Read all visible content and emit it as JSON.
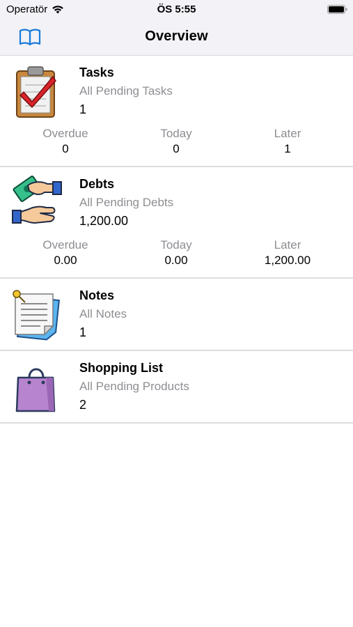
{
  "status_bar": {
    "carrier": "Operatör",
    "time": "ÖS 5:55"
  },
  "nav": {
    "title": "Overview",
    "left_icon": "book-icon"
  },
  "accent_color": "#1a7bd8",
  "sections": {
    "tasks": {
      "title": "Tasks",
      "subtitle": "All Pending Tasks",
      "count": "1",
      "stats": [
        {
          "label": "Overdue",
          "value": "0"
        },
        {
          "label": "Today",
          "value": "0"
        },
        {
          "label": "Later",
          "value": "1"
        }
      ]
    },
    "debts": {
      "title": "Debts",
      "subtitle": "All Pending Debts",
      "count": "1,200.00",
      "stats": [
        {
          "label": "Overdue",
          "value": "0.00"
        },
        {
          "label": "Today",
          "value": "0.00"
        },
        {
          "label": "Later",
          "value": "1,200.00"
        }
      ]
    },
    "notes": {
      "title": "Notes",
      "subtitle": "All Notes",
      "count": "1"
    },
    "shopping": {
      "title": "Shopping List",
      "subtitle": "All Pending Products",
      "count": "2"
    }
  }
}
